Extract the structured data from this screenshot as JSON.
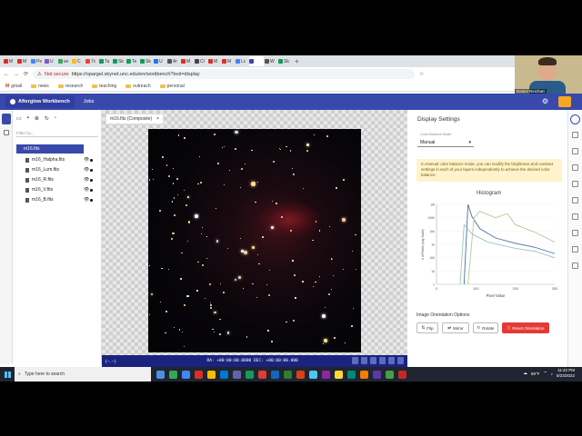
{
  "browser": {
    "tabs": [
      {
        "label": "M",
        "color": "#d93025"
      },
      {
        "label": "M",
        "color": "#d93025"
      },
      {
        "label": "Pe",
        "color": "#4285f4"
      },
      {
        "label": "U",
        "color": "#7e57c2"
      },
      {
        "label": "se",
        "color": "#34a853"
      },
      {
        "label": "C",
        "color": "#fbbc04"
      },
      {
        "label": "7c",
        "color": "#ea4335"
      },
      {
        "label": "Ta",
        "color": "#0f9d58"
      },
      {
        "label": "Sk",
        "color": "#0f9d58"
      },
      {
        "label": "Te",
        "color": "#0f9d58"
      },
      {
        "label": "Sk",
        "color": "#0f9d58"
      },
      {
        "label": "U",
        "color": "#1877f2"
      },
      {
        "label": "Ar",
        "color": "#555555"
      },
      {
        "label": "M",
        "color": "#d93025"
      },
      {
        "label": "Cl",
        "color": "#444444"
      },
      {
        "label": "M",
        "color": "#d93025"
      },
      {
        "label": "M",
        "color": "#d93025"
      },
      {
        "label": "Lc",
        "color": "#4285f4"
      },
      {
        "label": "",
        "color": "#3949ab"
      },
      {
        "label": "W",
        "color": "#555555"
      },
      {
        "label": "Sk",
        "color": "#0f9d58"
      }
    ],
    "not_secure": "Not secure",
    "url": "https://spargel.skynet.unc.edu/en/workbench?tool=display",
    "bookmarks": [
      "gmail",
      "news",
      "research",
      "teaching",
      "outreach",
      "personal"
    ]
  },
  "webcam": {
    "name": "Daniel Reichart"
  },
  "app": {
    "logo_text": "Afterglow Workbench",
    "jobs_label": "Jobs"
  },
  "left_panel": {
    "filter_placeholder": "Filter by...",
    "root_file": "m16.fits",
    "files": [
      "m16_Halpha.fits",
      "m16_Lum.fits",
      "m16_R.fits",
      "m16_V.fits",
      "m16_B.fits"
    ],
    "eye_glyph": "👁"
  },
  "viewer": {
    "tab_label": "m16.fits (Composite)",
    "tab_close": "×",
    "status_left": "(--, --)",
    "status_coords": "RA: +00:00:00.0000   DEC: +00:00:00.000"
  },
  "right_panel": {
    "title": "Display Settings",
    "mode_label": "Color Balance Mode",
    "mode_value": "Manual",
    "info_text": "In manual color balance mode, you can modify the brightness and contrast settings in each of your layers independently to achieve the desired color balance.",
    "histogram_title": "Histogram",
    "orientation_title": "Image Orientation Options",
    "buttons": {
      "flip": "Flip",
      "mirror": "Mirror",
      "rotate": "Rotate",
      "reset": "Reset Orientation"
    }
  },
  "chart_data": {
    "type": "line",
    "title": "Histogram",
    "xlabel": "Pixel Value",
    "ylabel": "# of Pixels (Log Scale)",
    "x_ticks": [
      "0",
      "100",
      "200",
      "300"
    ],
    "y_ticks": [
      "1M",
      "100k",
      "10k",
      "1k",
      "100",
      "10",
      "1"
    ],
    "xlim": [
      0,
      300
    ],
    "y_scale": "log",
    "series": [
      {
        "color": "#4a6fa5",
        "x": [
          70,
          80,
          90,
          110,
          150,
          200,
          250,
          300
        ],
        "y": [
          1,
          1000000,
          120000,
          15000,
          3000,
          1200,
          600,
          200
        ]
      },
      {
        "color": "#b7c79a",
        "x": [
          80,
          95,
          110,
          150,
          180,
          200,
          250,
          300
        ],
        "y": [
          1,
          100000,
          300000,
          100000,
          200000,
          30000,
          8000,
          1500
        ]
      },
      {
        "color": "#9cc5c2",
        "x": [
          60,
          70,
          90,
          130,
          200,
          250,
          300
        ],
        "y": [
          1,
          30000,
          6000,
          1500,
          500,
          300,
          100
        ]
      }
    ]
  },
  "taskbar": {
    "search_placeholder": "Type here to search",
    "weather": "59°F",
    "time": "11:42 PM",
    "date": "8/23/2022"
  }
}
